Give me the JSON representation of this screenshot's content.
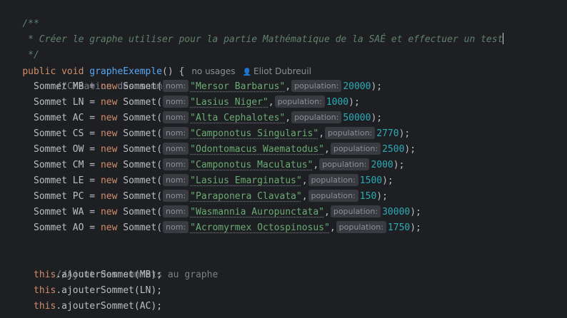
{
  "doc_comment": {
    "open": "/**",
    "body": " * Créer le graphe utiliser pour la partie Mathématique de la SAÉ et effectuer un test",
    "close": " */"
  },
  "method": {
    "modifier": "public",
    "return_type": "void",
    "name": "grapheExemple",
    "params": "()",
    "brace": " {",
    "usages": "no usages",
    "author": "Eliot Dubreuil",
    "author_icon": "user-icon"
  },
  "comment_sommets": "//Création des sommets",
  "sommets": [
    {
      "var": "MB",
      "nom": "Mersor Barbarus",
      "population": "20000"
    },
    {
      "var": "LN",
      "nom": "Lasius Niger",
      "population": "1000"
    },
    {
      "var": "AC",
      "nom": "Alta Cephalotes",
      "population": "50000"
    },
    {
      "var": "CS",
      "nom": "Camponotus Singularis",
      "population": "2770"
    },
    {
      "var": "OW",
      "nom": "Odontomacus Waematodus",
      "population": "2500"
    },
    {
      "var": "CM",
      "nom": "Camponotus Maculatus",
      "population": "2000"
    },
    {
      "var": "LE",
      "nom": "Lasius Emarginatus",
      "population": "1500"
    },
    {
      "var": "PC",
      "nom": "Paraponera Clavata",
      "population": "150"
    },
    {
      "var": "WA",
      "nom": "Wasmannia Auropunctata",
      "population": "30000"
    },
    {
      "var": "AO",
      "nom": "Acromyrmex Octospinosus",
      "population": "1750"
    }
  ],
  "hints": {
    "nom": "nom:",
    "population": "population:"
  },
  "tokens": {
    "type": "Sommet",
    "new": "new",
    "this": "this",
    "call": ".ajouterSommet"
  },
  "comment_ajout": "//Ajout des sommets au graphe",
  "ajouts": [
    "MB",
    "LN",
    "AC"
  ],
  "colors": {
    "background": "#1e1f22",
    "keyword": "#cf8e6d",
    "string": "#6aab73",
    "number": "#2aacb8",
    "comment": "#7a7e85",
    "doc_comment": "#5f826b",
    "function": "#56a8f5"
  }
}
